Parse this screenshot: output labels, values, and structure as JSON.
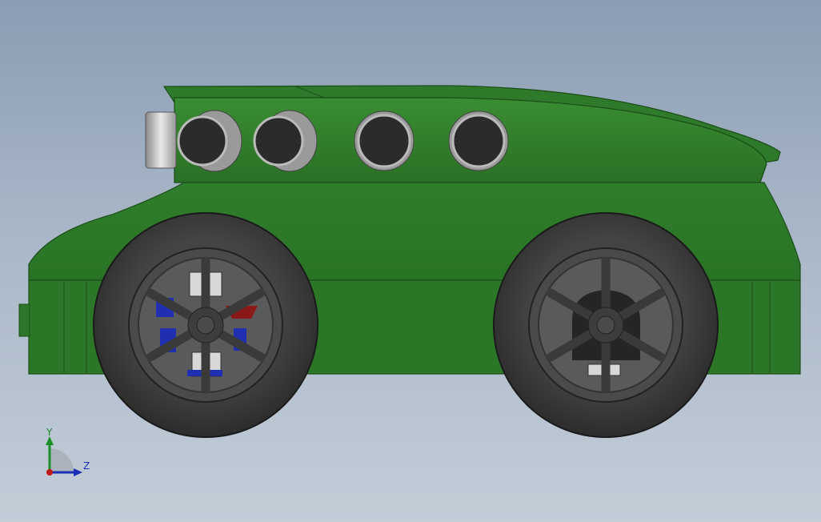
{
  "viewport": {
    "background_top": "#8b9db3",
    "background_bottom": "#c3cdd8"
  },
  "model": {
    "body_color": "#2f7a2a",
    "body_dark": "#1f5a1c",
    "tire_color": "#3a3a3a",
    "rim_color": "#555555",
    "sensor_color": "#2b2b2b",
    "servo_blue": "#1f2fb0",
    "part_red": "#8a1a1a"
  },
  "triad": {
    "y_label": "Y",
    "z_label": "Z",
    "y_color": "#1c8f2a",
    "z_color": "#1a2fb5",
    "x_color": "#c21818"
  }
}
